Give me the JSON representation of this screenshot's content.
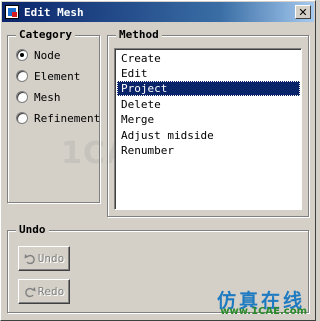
{
  "window": {
    "title": "Edit Mesh",
    "close_glyph": "✕"
  },
  "category": {
    "legend": "Category",
    "options": [
      {
        "label": "Node",
        "checked": true
      },
      {
        "label": "Element",
        "checked": false
      },
      {
        "label": "Mesh",
        "checked": false
      },
      {
        "label": "Refinement",
        "checked": false
      }
    ]
  },
  "method": {
    "legend": "Method",
    "items": [
      "Create",
      "Edit",
      "Project",
      "Delete",
      "Merge",
      "Adjust midside",
      "Renumber"
    ],
    "selected": "Project"
  },
  "undo": {
    "legend": "Undo",
    "undo_label": "Undo",
    "redo_label": "Redo",
    "enabled": false
  },
  "watermark": {
    "text": "1CAE.COM",
    "logo_cn": "仿真在线",
    "logo_url": "www.1CAE.com"
  },
  "colors": {
    "face": "#d4d0c8",
    "selection": "#0a246a",
    "title_gradient_start": "#0a246a",
    "disabled_text": "#808080"
  },
  "icons": {
    "app": "mesh-app-icon",
    "close": "close-icon",
    "undo": "undo-arrow-icon",
    "redo": "redo-arrow-icon"
  }
}
